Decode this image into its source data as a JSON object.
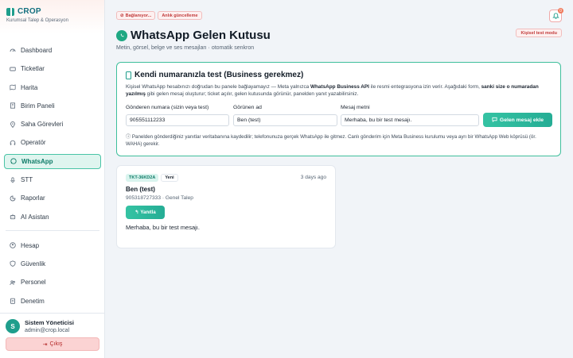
{
  "brand": {
    "name": "CROP",
    "subtitle": "Kurumsal Talep & Operasyon"
  },
  "sidebar": {
    "items": [
      {
        "label": "Dashboard",
        "icon": "dashboard-icon"
      },
      {
        "label": "Ticketlar",
        "icon": "ticket-icon"
      },
      {
        "label": "Harita",
        "icon": "map-icon"
      },
      {
        "label": "Birim Paneli",
        "icon": "building-icon"
      },
      {
        "label": "Saha Görevleri",
        "icon": "location-pin-icon"
      },
      {
        "label": "Operatör",
        "icon": "headset-icon"
      },
      {
        "label": "WhatsApp",
        "icon": "whatsapp-icon",
        "active": true
      },
      {
        "label": "STT",
        "icon": "microphone-icon"
      },
      {
        "label": "Raporlar",
        "icon": "chart-icon"
      },
      {
        "label": "AI Asistan",
        "icon": "robot-icon"
      }
    ],
    "items2": [
      {
        "label": "Hesap",
        "icon": "user-icon"
      },
      {
        "label": "Güvenlik",
        "icon": "shield-icon"
      },
      {
        "label": "Personel",
        "icon": "users-icon"
      },
      {
        "label": "Denetim",
        "icon": "clipboard-icon"
      }
    ]
  },
  "user": {
    "initial": "S",
    "name": "Sistem Yöneticisi",
    "email": "admin@crop.local",
    "logout_label": "Çıkış"
  },
  "header": {
    "chips": [
      "Bağlanıyor...",
      "Anlık güncelleme"
    ],
    "notification_count": "0",
    "test_mode_label": "Kişisel test modu",
    "title": "WhatsApp Gelen Kutusu",
    "subtitle": "Metin, görsel, belge ve ses mesajları · otomatik senkron"
  },
  "test_panel": {
    "title": "Kendi numaranızla test (Business gerekmez)",
    "desc_1": "Kişisel WhatsApp hesabınızı doğrudan bu panele bağlayamayız — Meta yalnızca ",
    "desc_bold_1": "WhatsApp Business API",
    "desc_2": " ile resmi entegrasyona izin verir. Aşağıdaki form, ",
    "desc_bold_2": "sanki size o numaradan yazılmış",
    "desc_3": " gibi gelen mesaj oluşturur; ticket açılır, gelen kutusunda görünür, panelden yanıt yazabilirsiniz.",
    "sender_label": "Gönderen numara (sizin veya test)",
    "sender_value": "905551112233",
    "name_label": "Görünen ad",
    "name_value": "Ben (test)",
    "message_label": "Mesaj metni",
    "message_value": "Merhaba, bu bir test mesajı.",
    "add_button": "Gelen mesaj ekle",
    "note": "Panelden gönderdiğiniz yanıtlar veritabanına kaydedilir; telefonunuza gerçek WhatsApp ile gitmez. Canlı gönderim için Meta Business kurulumu veya ayrı bir WhatsApp Web köprüsü (ör. WAHA) gerekir."
  },
  "messages": [
    {
      "ticket_id": "TKT-36KD2A",
      "status": "Yeni",
      "time": "3 days ago",
      "name": "Ben (test)",
      "meta": "905318727333 · Genel Talep",
      "reply_label": "Yanıtla",
      "text": "Merhaba, bu bir test mesajı."
    }
  ],
  "colors": {
    "accent": "#1f9e8c",
    "active_bg": "#dff5ef",
    "danger": "#c23a3a"
  }
}
